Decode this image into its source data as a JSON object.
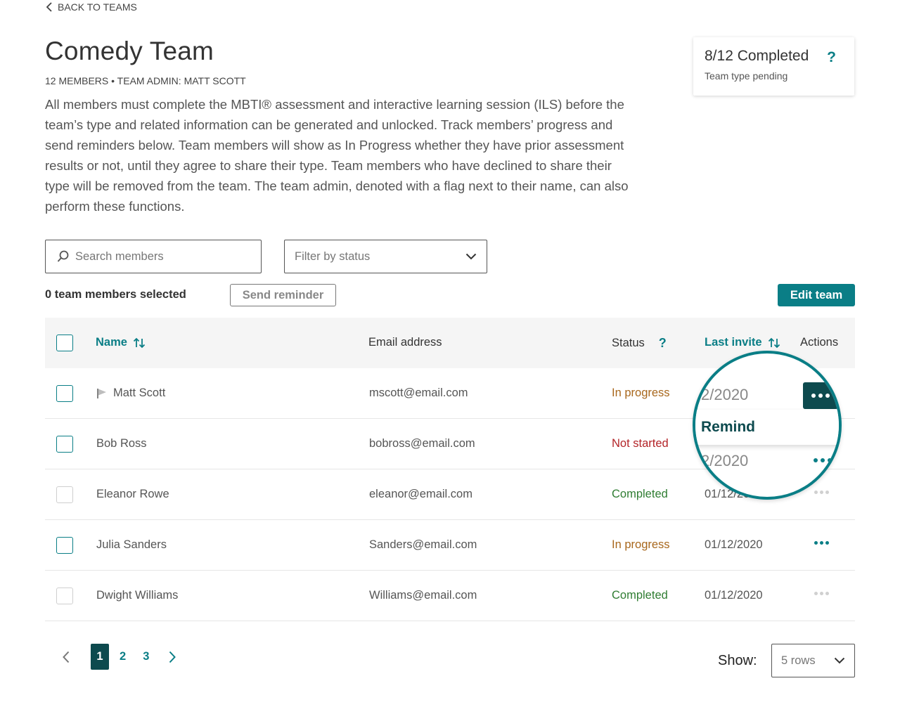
{
  "nav": {
    "back_label": "BACK TO TEAMS"
  },
  "team": {
    "title": "Comedy Team",
    "meta": "12 MEMBERS • TEAM ADMIN: MATT SCOTT",
    "description": "All members must complete the MBTI® assessment and interactive learning session (ILS) before the team’s type and related information can be generated and unlocked. Track members’ progress and send reminders below. Team members will show as In Progress whether they have prior assessment results or not, until they agree to share their type. Team members who have declined to share their type will be removed from the team. The team admin, denoted with a flag next to their name, can also perform these functions."
  },
  "completion": {
    "title": "8/12 Completed",
    "subtitle": "Team type pending",
    "help": "?"
  },
  "toolbar": {
    "search_placeholder": "Search members",
    "filter_placeholder": "Filter by status",
    "selected_count": "0 team members selected",
    "send_reminder_label": "Send reminder",
    "edit_team_label": "Edit team"
  },
  "table": {
    "headers": {
      "name": "Name",
      "email": "Email address",
      "status": "Status",
      "status_help": "?",
      "last_invite": "Last invite",
      "actions": "Actions"
    },
    "rows": [
      {
        "name": "Matt Scott",
        "email": "mscott@email.com",
        "status": "In progress",
        "date": "",
        "admin": true
      },
      {
        "name": "Bob Ross",
        "email": "bobross@email.com",
        "status": "Not started",
        "date": ""
      },
      {
        "name": "Eleanor Rowe",
        "email": "eleanor@email.com",
        "status": "Completed",
        "date": "01/12/2020"
      },
      {
        "name": "Julia Sanders",
        "email": "Sanders@email.com",
        "status": "In progress",
        "date": "01/12/2020"
      },
      {
        "name": "Dwight Williams",
        "email": "Williams@email.com",
        "status": "Completed",
        "date": "01/12/2020"
      }
    ]
  },
  "magnifier": {
    "date_1": "2/2020",
    "date_2": "2/2020",
    "menu_item": "Remind"
  },
  "pagination": {
    "pages": [
      "1",
      "2",
      "3"
    ],
    "current": "1"
  },
  "show": {
    "label": "Show:",
    "rows_value": "5 rows"
  },
  "colors": {
    "accent": "#0a7e86",
    "dark_accent": "#0d4a4e",
    "in_progress": "#a8671c",
    "not_started": "#b32428",
    "completed": "#2f7d32"
  }
}
